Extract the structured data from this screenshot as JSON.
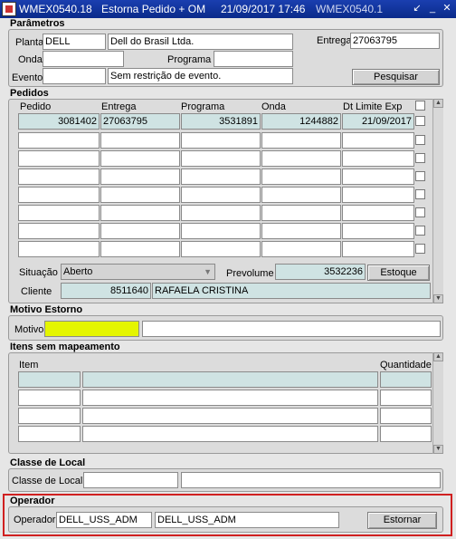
{
  "window": {
    "title_app": "WMEX0540.18",
    "title_screen": "Estorna Pedido + OM",
    "title_datetime": "21/09/2017 17:46",
    "title_extra": "WMEX0540.1"
  },
  "parametros": {
    "title": "Parâmetros",
    "planta_label": "Planta",
    "planta_code": "DELL",
    "planta_name": "Dell do Brasil Ltda.",
    "entrega_label": "Entrega",
    "entrega_value": "27063795",
    "onda_label": "Onda",
    "onda_value": "",
    "programa_label": "Programa",
    "programa_value": "",
    "evento_label": "Evento",
    "evento_code": "",
    "evento_desc": "Sem restrição de evento.",
    "pesquisar_label": "Pesquisar"
  },
  "pedidos": {
    "title": "Pedidos",
    "columns": [
      "Pedido",
      "Entrega",
      "Programa",
      "Onda",
      "Dt Limite Exp"
    ],
    "rows": [
      [
        "3081402",
        "27063795",
        "3531891",
        "1244882",
        "21/09/2017"
      ],
      [
        "",
        "",
        "",
        "",
        ""
      ],
      [
        "",
        "",
        "",
        "",
        ""
      ],
      [
        "",
        "",
        "",
        "",
        ""
      ],
      [
        "",
        "",
        "",
        "",
        ""
      ],
      [
        "",
        "",
        "",
        "",
        ""
      ],
      [
        "",
        "",
        "",
        "",
        ""
      ],
      [
        "",
        "",
        "",
        "",
        ""
      ]
    ],
    "situacao_label": "Situação",
    "situacao_value": "Aberto",
    "prevolume_label": "Prevolume",
    "prevolume_value": "3532236",
    "estoque_label": "Estoque",
    "cliente_label": "Cliente",
    "cliente_code": "8511640",
    "cliente_name": "RAFAELA CRISTINA"
  },
  "motivo": {
    "title": "Motivo Estorno",
    "motivo_label": "Motivo",
    "motivo_code": "",
    "motivo_desc": ""
  },
  "itens": {
    "title": "Itens sem mapeamento",
    "col_item": "Item",
    "col_quantidade": "Quantidade"
  },
  "classe": {
    "title": "Classe de Local",
    "label": "Classe de Local",
    "code": "",
    "desc": ""
  },
  "operador": {
    "title": "Operador",
    "label": "Operador",
    "code": "DELL_USS_ADM",
    "name": "DELL_USS_ADM",
    "estornar_label": "Estornar"
  },
  "colors": {
    "titlebar": "#0a2a8a",
    "readonly_field": "#cfe3e3",
    "required_field": "#e4f500",
    "highlight_frame": "#d02020"
  }
}
